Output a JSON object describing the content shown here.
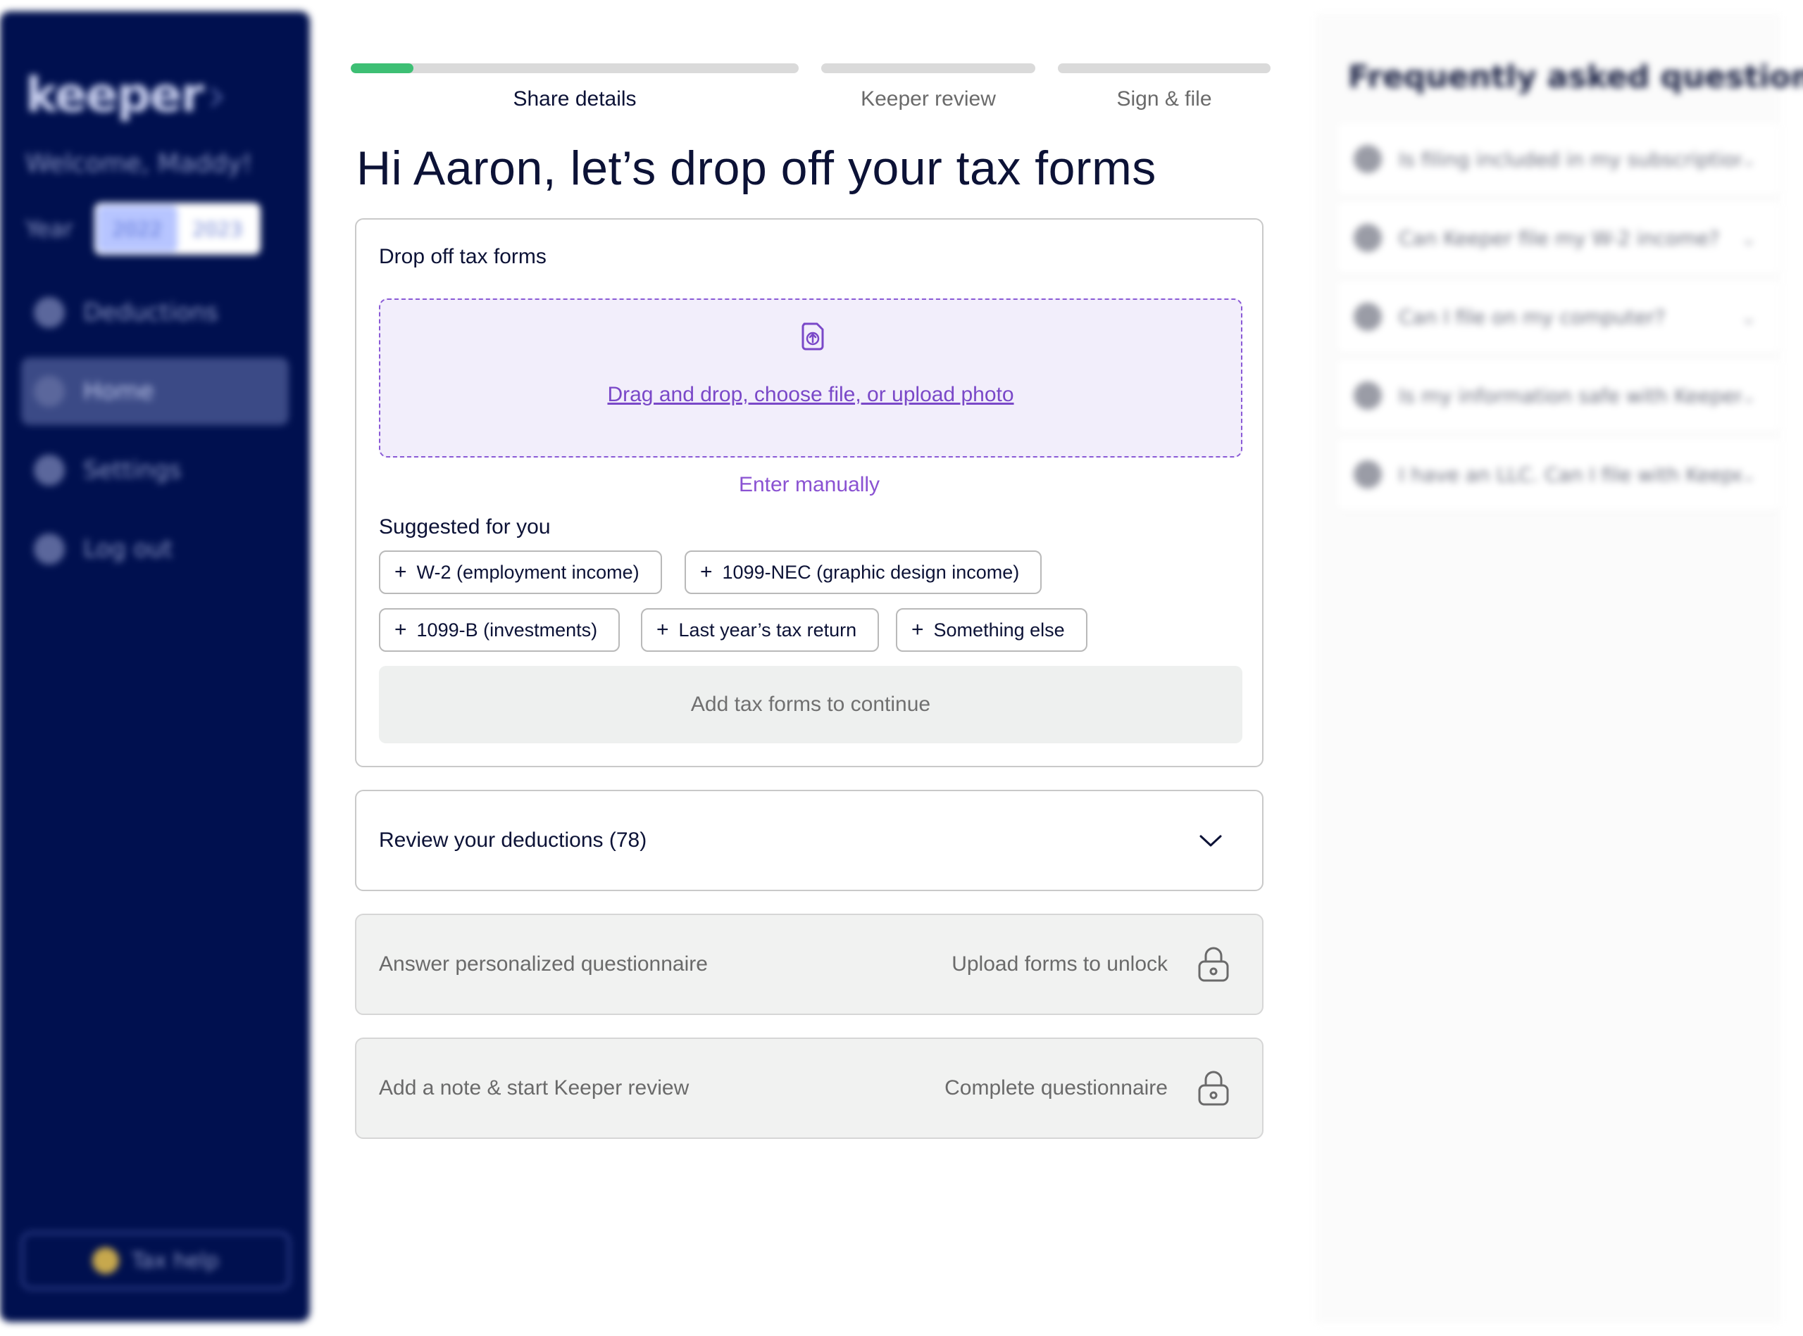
{
  "sidebar": {
    "logo": "keeper",
    "welcome": "Welcome, Maddy!",
    "year_label": "Year",
    "years": [
      "2022",
      "2023"
    ],
    "nav": [
      {
        "label": "Deductions",
        "icon": "deductions-icon"
      },
      {
        "label": "Home",
        "icon": "home-icon"
      },
      {
        "label": "Settings",
        "icon": "settings-icon"
      },
      {
        "label": "Log out",
        "icon": "logout-icon"
      }
    ],
    "help_label": "Tax help"
  },
  "steps": [
    {
      "label": "Share details",
      "progress": 0.14
    },
    {
      "label": "Keeper review",
      "progress": 0
    },
    {
      "label": "Sign & file",
      "progress": 0
    }
  ],
  "heading": "Hi Aaron, let’s drop off your tax forms",
  "dropoff": {
    "title": "Drop off tax forms",
    "drop_link": "Drag and drop, choose file, or upload photo",
    "enter_manually": "Enter manually",
    "suggested_title": "Suggested for you",
    "chips": [
      "W-2 (employment income)",
      "1099-NEC (graphic design income)",
      "1099-B (investments)",
      "Last year’s tax return",
      "Something else"
    ],
    "continue_label": "Add tax forms to continue"
  },
  "deductions": {
    "title": "Review your deductions (78)"
  },
  "questionnaire": {
    "title": "Answer personalized questionnaire",
    "lock_text": "Upload forms to unlock"
  },
  "review": {
    "title": "Add a note & start Keeper review",
    "lock_text": "Complete questionnaire"
  },
  "faq": {
    "title": "Frequently asked questions",
    "items": [
      "Is filing included in my subscription?",
      "Can Keeper file my W-2 income?",
      "Can I file on my computer?",
      "Is my information safe with Keeper?",
      "I have an LLC. Can I file with Keeper?"
    ]
  },
  "colors": {
    "sidebar_bg": "#00104f",
    "progress_fill": "#3dbf74",
    "accent_purple": "#7a48c8",
    "dropzone_bg": "#f2eefb"
  }
}
